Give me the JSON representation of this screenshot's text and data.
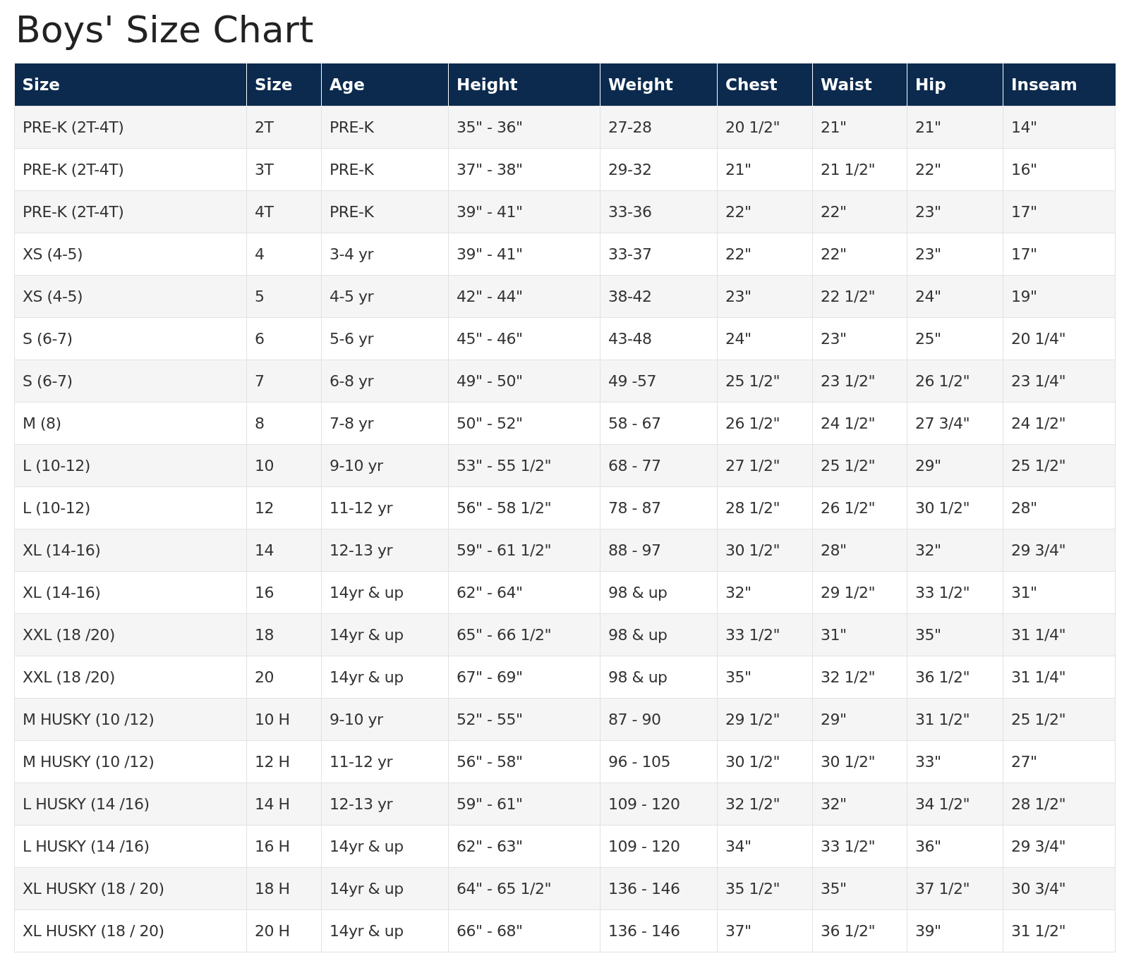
{
  "title": "Boys' Size Chart",
  "table": {
    "columns": [
      "Size",
      "Size",
      "Age",
      "Height",
      "Weight",
      "Chest",
      "Waist",
      "Hip",
      "Inseam"
    ],
    "rows": [
      [
        "PRE-K (2T-4T)",
        "2T",
        "PRE-K",
        "35\" - 36\"",
        "27-28",
        "20 1/2\"",
        "21\"",
        "21\"",
        "14\""
      ],
      [
        "PRE-K (2T-4T)",
        "3T",
        "PRE-K",
        "37\" - 38\"",
        "29-32",
        "21\"",
        "21 1/2\"",
        "22\"",
        "16\""
      ],
      [
        "PRE-K (2T-4T)",
        "4T",
        "PRE-K",
        "39\" - 41\"",
        "33-36",
        "22\"",
        "22\"",
        "23\"",
        "17\""
      ],
      [
        "XS (4-5)",
        "4",
        "3-4 yr",
        "39\" - 41\"",
        "33-37",
        "22\"",
        "22\"",
        "23\"",
        "17\""
      ],
      [
        "XS (4-5)",
        "5",
        "4-5 yr",
        "42\" - 44\"",
        "38-42",
        "23\"",
        "22 1/2\"",
        "24\"",
        "19\""
      ],
      [
        "S (6-7)",
        "6",
        "5-6 yr",
        "45\" - 46\"",
        "43-48",
        "24\"",
        "23\"",
        "25\"",
        "20 1/4\""
      ],
      [
        "S (6-7)",
        "7",
        "6-8 yr",
        "49\" - 50\"",
        "49 -57",
        "25 1/2\"",
        "23 1/2\"",
        "26 1/2\"",
        "23 1/4\""
      ],
      [
        "M (8)",
        "8",
        "7-8 yr",
        "50\" - 52\"",
        "58 - 67",
        "26 1/2\"",
        "24 1/2\"",
        "27 3/4\"",
        "24 1/2\""
      ],
      [
        "L (10-12)",
        "10",
        "9-10 yr",
        "53\" - 55 1/2\"",
        "68 - 77",
        "27 1/2\"",
        "25 1/2\"",
        "29\"",
        "25 1/2\""
      ],
      [
        "L (10-12)",
        "12",
        "11-12 yr",
        "56\" - 58 1/2\"",
        "78 - 87",
        "28 1/2\"",
        "26 1/2\"",
        "30 1/2\"",
        "28\""
      ],
      [
        "XL (14-16)",
        "14",
        "12-13 yr",
        "59\" - 61 1/2\"",
        "88 - 97",
        "30 1/2\"",
        "28\"",
        "32\"",
        "29 3/4\""
      ],
      [
        "XL (14-16)",
        "16",
        "14yr & up",
        "62\" - 64\"",
        "98 & up",
        "32\"",
        "29 1/2\"",
        "33 1/2\"",
        "31\""
      ],
      [
        "XXL (18 /20)",
        "18",
        "14yr & up",
        "65\" - 66 1/2\"",
        "98 & up",
        "33 1/2\"",
        "31\"",
        "35\"",
        "31 1/4\""
      ],
      [
        "XXL (18 /20)",
        "20",
        "14yr & up",
        "67\" - 69\"",
        "98 & up",
        "35\"",
        "32 1/2\"",
        "36 1/2\"",
        "31 1/4\""
      ],
      [
        "M HUSKY (10 /12)",
        "10 H",
        "9-10 yr",
        "52\" - 55\"",
        "87 - 90",
        "29 1/2\"",
        "29\"",
        "31 1/2\"",
        "25 1/2\""
      ],
      [
        "M HUSKY (10 /12)",
        "12 H",
        "11-12 yr",
        "56\" - 58\"",
        "96 - 105",
        "30 1/2\"",
        "30 1/2\"",
        "33\"",
        "27\""
      ],
      [
        "L HUSKY (14 /16)",
        "14 H",
        "12-13 yr",
        "59\" - 61\"",
        "109 - 120",
        "32 1/2\"",
        "32\"",
        "34 1/2\"",
        "28 1/2\""
      ],
      [
        "L HUSKY (14 /16)",
        "16 H",
        "14yr & up",
        "62\" - 63\"",
        "109 - 120",
        "34\"",
        "33 1/2\"",
        "36\"",
        "29 3/4\""
      ],
      [
        "XL HUSKY (18 / 20)",
        "18 H",
        "14yr & up",
        "64\" - 65 1/2\"",
        "136 - 146",
        "35 1/2\"",
        "35\"",
        "37 1/2\"",
        "30 3/4\""
      ],
      [
        "XL HUSKY (18 / 20)",
        "20 H",
        "14yr & up",
        "66\" - 68\"",
        "136 - 146",
        "37\"",
        "36 1/2\"",
        "39\"",
        "31 1/2\""
      ]
    ]
  }
}
